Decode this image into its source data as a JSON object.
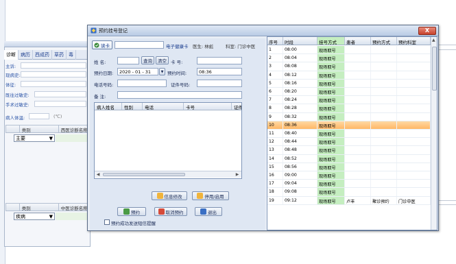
{
  "background": {
    "tabs": [
      "诊断",
      "病历",
      "西成药",
      "草药",
      "毒"
    ],
    "fields": [
      "主诉:",
      "现病史:",
      "体征:",
      "既往过敏史:",
      "手术过敏史:",
      "病人体温:"
    ],
    "temp_unit": "(℃)",
    "grid1": {
      "cols": [
        "类别",
        "西医诊断名称"
      ],
      "combo": "主要"
    },
    "grid2": {
      "cols": [
        "类别",
        "中医诊断名称"
      ],
      "combo": "疾病"
    }
  },
  "dialog": {
    "title": "预约挂号登记",
    "close_label": "X",
    "toolbar": {
      "read_card_label": "读卡",
      "ecard_label": "电子健康卡",
      "doctor_label": "医生: 林彪",
      "dept_label": "科室: 门诊中医"
    },
    "form": {
      "name_label": "姓  名:",
      "query_label": "查询",
      "clear_label": "清空",
      "card_label": "卡  号:",
      "date_label": "预约日期:",
      "date_value": "2020 - 01 - 31",
      "time_label": "预约时间:",
      "time_value": "08:36",
      "phone_label": "电话号码:",
      "id_label": "证件号码:",
      "note_label": "备  注:"
    },
    "patient_grid": {
      "cols": [
        "病人姓名",
        "性别",
        "电话",
        "卡号",
        "证件"
      ]
    },
    "buttons": {
      "modify": "信息修改",
      "disable": "停用/启用",
      "book": "预约",
      "cancel_booking": "取消预约",
      "exit": "退出"
    },
    "sms_checkbox_label": "预约成功发送短信提醒",
    "table": {
      "headers": [
        "序号",
        "时段",
        "挂号方式",
        "患者",
        "预约方式",
        "预约科室"
      ],
      "rows": [
        [
          "1",
          "08:00",
          "现场取号",
          "",
          "",
          ""
        ],
        [
          "2",
          "08:04",
          "现场取号",
          "",
          "",
          ""
        ],
        [
          "3",
          "08:08",
          "现场取号",
          "",
          "",
          ""
        ],
        [
          "4",
          "08:12",
          "现场取号",
          "",
          "",
          ""
        ],
        [
          "5",
          "08:16",
          "现场取号",
          "",
          "",
          ""
        ],
        [
          "6",
          "08:20",
          "现场取号",
          "",
          "",
          ""
        ],
        [
          "7",
          "08:24",
          "现场取号",
          "",
          "",
          ""
        ],
        [
          "8",
          "08:28",
          "现场取号",
          "",
          "",
          ""
        ],
        [
          "9",
          "08:32",
          "现场取号",
          "",
          "",
          ""
        ],
        [
          "10",
          "08:36",
          "现场取号",
          "",
          "",
          ""
        ],
        [
          "11",
          "08:40",
          "现场取号",
          "",
          "",
          ""
        ],
        [
          "12",
          "08:44",
          "现场取号",
          "",
          "",
          ""
        ],
        [
          "13",
          "08:48",
          "现场取号",
          "",
          "",
          ""
        ],
        [
          "14",
          "08:52",
          "现场取号",
          "",
          "",
          ""
        ],
        [
          "15",
          "08:56",
          "现场取号",
          "",
          "",
          ""
        ],
        [
          "16",
          "09:00",
          "现场取号",
          "",
          "",
          ""
        ],
        [
          "17",
          "09:04",
          "现场取号",
          "",
          "",
          ""
        ],
        [
          "18",
          "09:08",
          "现场取号",
          "",
          "",
          ""
        ],
        [
          "19",
          "09:12",
          "现场取号",
          "卢丰",
          "聚诊预约",
          "门诊中医"
        ]
      ],
      "selected_row": "10"
    }
  },
  "colors": {
    "selected_row": "#ffb766",
    "green_column": "#c5eec0",
    "title_bar": "#b9cbe4"
  }
}
